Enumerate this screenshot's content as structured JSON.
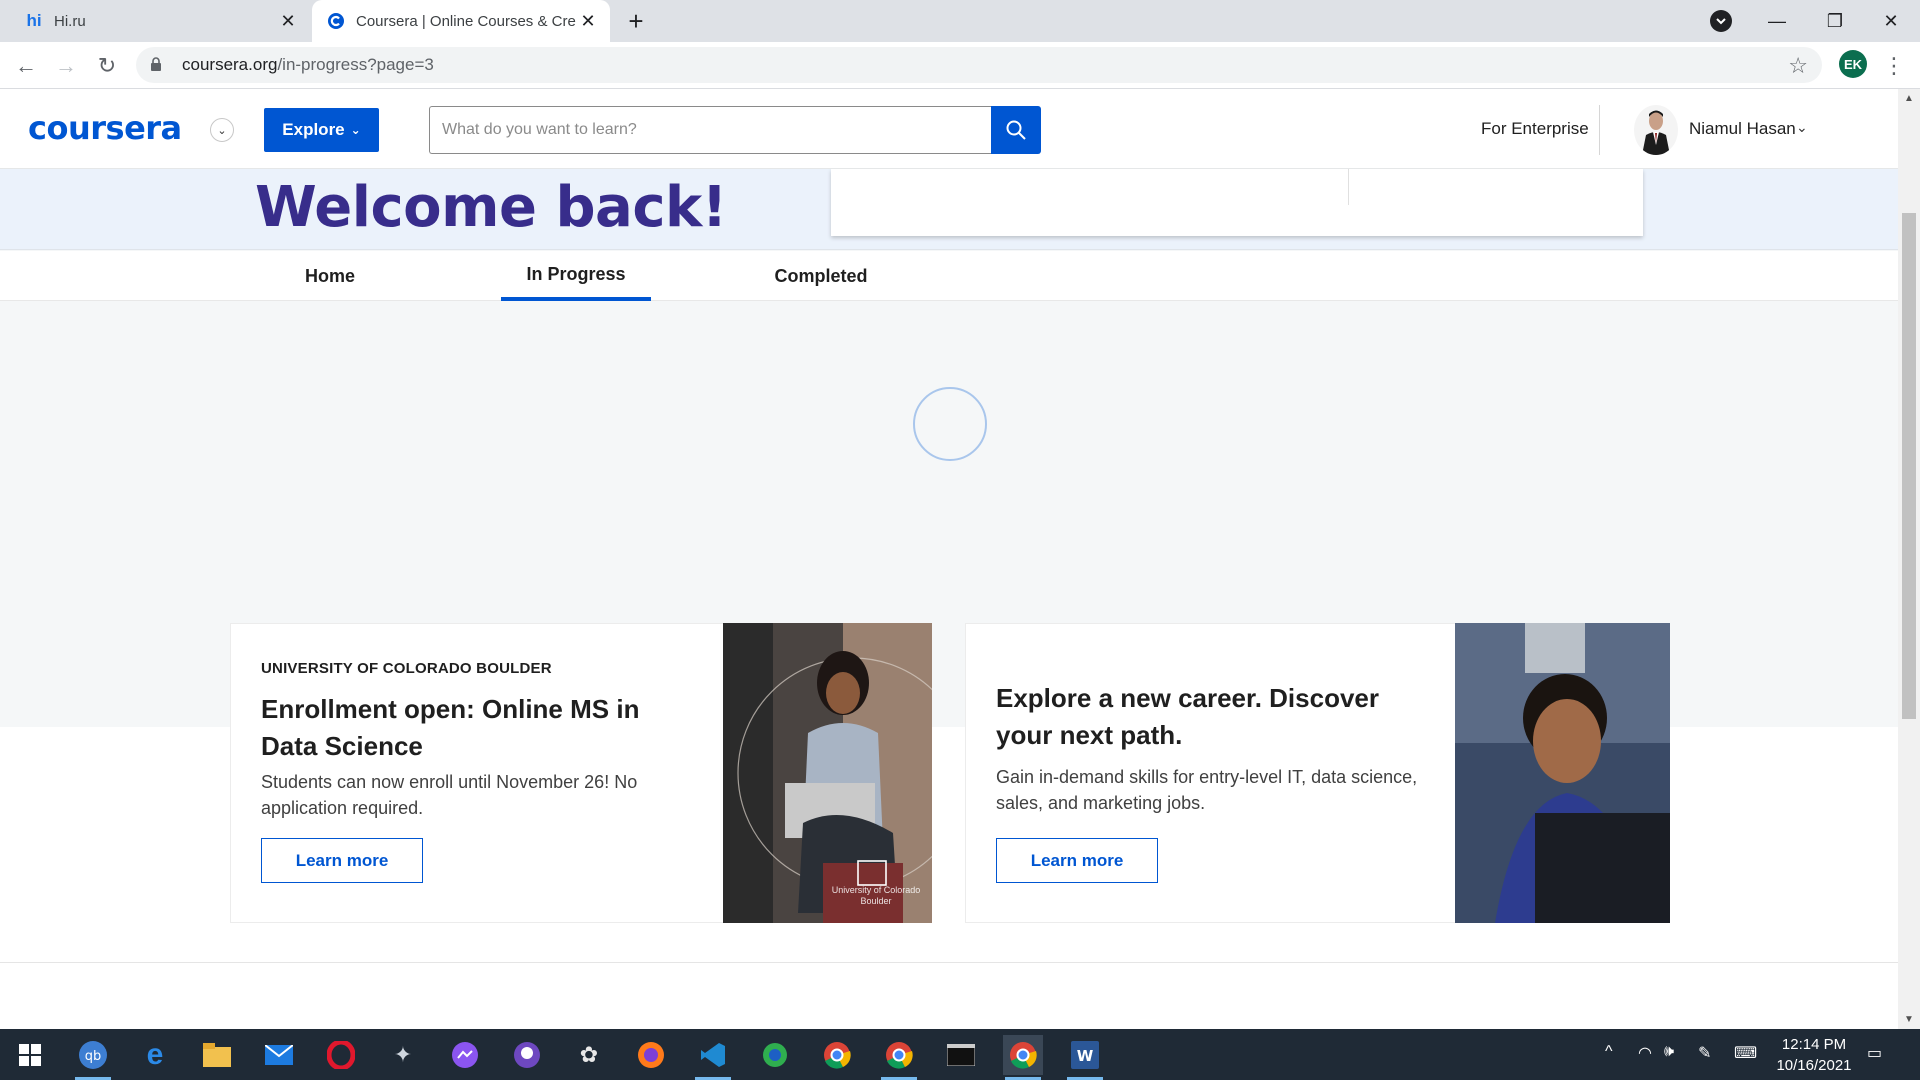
{
  "browser": {
    "tabs": [
      {
        "title": "Hi.ru",
        "favicon": "hi",
        "active": false
      },
      {
        "title": "Coursera | Online Courses & Cred",
        "favicon": "coursera-icon",
        "active": true
      }
    ],
    "url_host": "coursera.org",
    "url_path": "/in-progress?page=3",
    "profile_initials": "EK"
  },
  "header": {
    "logo": "coursera",
    "explore_label": "Explore",
    "search_placeholder": "What do you want to learn?",
    "enterprise_label": "For Enterprise",
    "user_name": "Niamul Hasan"
  },
  "welcome": {
    "title": "Welcome back!"
  },
  "page_tabs": [
    {
      "label": "Home",
      "active": false
    },
    {
      "label": "In Progress",
      "active": true
    },
    {
      "label": "Completed",
      "active": false
    }
  ],
  "promos": [
    {
      "eyebrow": "UNIVERSITY OF COLORADO BOULDER",
      "title_line1": "Enrollment open: Online MS in",
      "title_line2": "Data Science",
      "desc_line1": "Students can now enroll until November 26! No",
      "desc_line2": "application required.",
      "button": "Learn more",
      "image_watermark_line1": "University of Colorado",
      "image_watermark_line2": "Boulder"
    },
    {
      "title_line1": "Explore a new career. Discover",
      "title_line2": "your next path.",
      "desc_line1": "Gain in-demand skills for entry-level IT, data science,",
      "desc_line2": "sales, and marketing jobs.",
      "button": "Learn more"
    }
  ],
  "taskbar": {
    "time": "12:14 PM",
    "date": "10/16/2021"
  },
  "colors": {
    "brand": "#0056d2",
    "welcome_text": "#382d8b",
    "welcome_band": "#ebf2fb"
  }
}
